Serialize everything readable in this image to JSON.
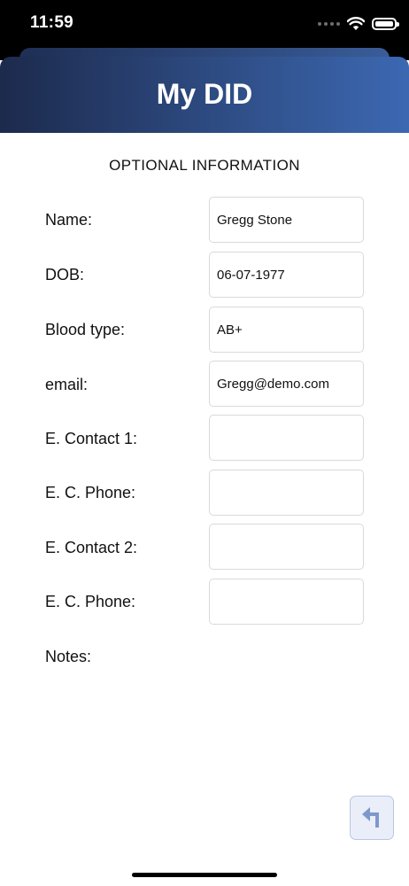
{
  "status_bar": {
    "time": "11:59"
  },
  "header": {
    "title": "My DID"
  },
  "section_title": "OPTIONAL INFORMATION",
  "fields": [
    {
      "label": "Name:",
      "value": "Gregg Stone"
    },
    {
      "label": "DOB:",
      "value": "06-07-1977"
    },
    {
      "label": "Blood type:",
      "value": "AB+"
    },
    {
      "label": "email:",
      "value": "Gregg@demo.com"
    },
    {
      "label": "E. Contact 1:",
      "value": ""
    },
    {
      "label": "E. C. Phone:",
      "value": ""
    },
    {
      "label": "E. Contact 2:",
      "value": ""
    },
    {
      "label": "E. C. Phone:",
      "value": ""
    }
  ],
  "notes_label": "Notes:",
  "icons": {
    "back": "return-arrow-icon",
    "wifi": "wifi-icon",
    "battery": "battery-icon",
    "signal": "cellular-signal-icon"
  },
  "colors": {
    "header_start": "#1c2a4c",
    "header_end": "#3c68b2",
    "button_bg": "#e9eef9",
    "button_icon": "#7f98cc"
  }
}
